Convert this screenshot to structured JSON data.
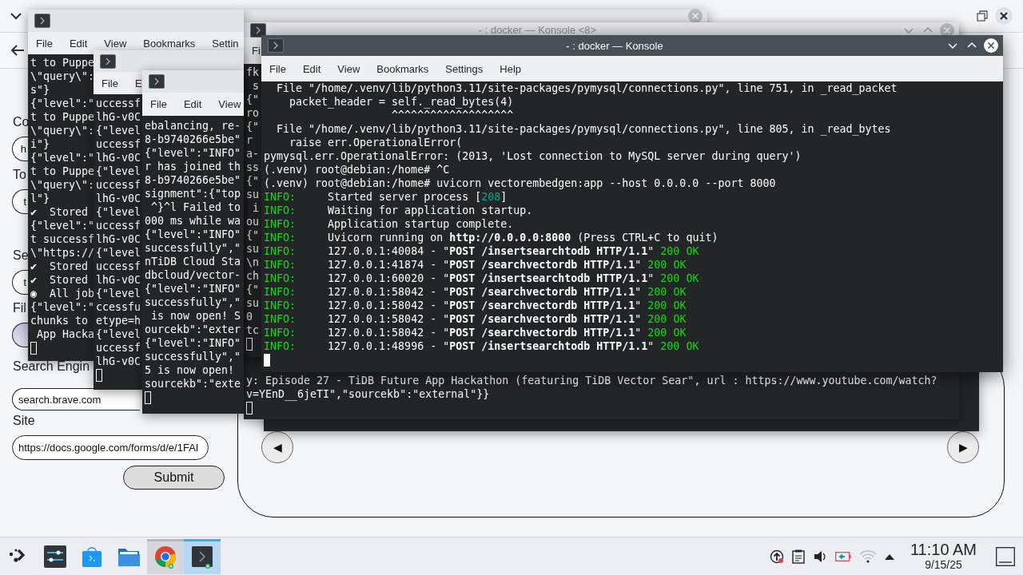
{
  "browser": {
    "form": {
      "fields": [
        {
          "kind": "text",
          "label": "Co",
          "value": "h"
        },
        {
          "kind": "text",
          "label": "To",
          "value": "t"
        },
        {
          "kind": "text",
          "label": "Se",
          "value": "t"
        },
        {
          "kind": "file",
          "label": "Fil"
        },
        {
          "kind": "text",
          "label": "Search Engin",
          "value": "search.brave.com"
        },
        {
          "kind": "text",
          "label": "Site",
          "value": "https://docs.google.com/forms/d/e/1FAI"
        }
      ],
      "submit": "Submit"
    },
    "carousel": {
      "prev": "◀",
      "next": "▶"
    }
  },
  "windows": [
    {
      "active": false
    },
    {
      "active": false,
      "menu": [
        "File",
        "Edit",
        "View",
        "Bookmarks",
        "Settin"
      ],
      "lines": [
        "t to Puppe",
        "\\\"query\\\":",
        "s\"}",
        "{\"level\":\"",
        "t to Puppe",
        "\\\"query\\\":",
        "i\"}",
        "{\"level\":\"",
        "t to Puppe",
        "\\\"query\\\":",
        "l\"}",
        "✔  Stored",
        "{\"level\":\"",
        "t successf",
        "\\\"https://",
        "✔  Stored",
        "✔  Stored",
        "◉  All job",
        "{\"level\":\"",
        "chunks to",
        " App Hacka"
      ]
    },
    {
      "active": false,
      "title": "- : docker — Konsole <8>",
      "menu": [
        "Fi"
      ],
      "lines": [
        "fk",
        " s",
        "{\"",
        "ro",
        "{\"",
        "r ",
        "a-",
        "ss",
        "{\"",
        "su",
        " i",
        "ou",
        "{\"",
        "su",
        "\\n",
        "ch",
        "{\"",
        "su",
        "0 ",
        "tc"
      ]
    },
    {
      "active": true,
      "title": "- : docker — Konsole",
      "menu": [
        "File",
        "Edit",
        "View",
        "Bookmarks",
        "Settings",
        "Help"
      ],
      "lines": [
        "  File \"/home/.venv/lib/python3.11/site-packages/pymysql/connections.py\", line 751, in _read_packet",
        "    packet_header = self._read_bytes(4)",
        "                    ^^^^^^^^^^^^^^^^^^^",
        "  File \"/home/.venv/lib/python3.11/site-packages/pymysql/connections.py\", line 805, in _read_bytes",
        "    raise err.OperationalError(",
        "pymysql.err.OperationalError: (2013, 'Lost connection to MySQL server during query')",
        "(.venv) root@debian:/home# ^C",
        "(.venv) root@debian:/home# uvicorn vectorembedgen:app --host 0.0.0.0 --port 8000",
        {
          "spans": [
            {
              "text": "INFO:",
              "kind": "level"
            },
            {
              "text": "     Started server process ["
            },
            {
              "text": "208",
              "kind": "pid"
            },
            {
              "text": "]"
            }
          ]
        },
        {
          "spans": [
            {
              "text": "INFO:",
              "kind": "level"
            },
            {
              "text": "     Waiting for application startup."
            }
          ]
        },
        {
          "spans": [
            {
              "text": "INFO:",
              "kind": "level"
            },
            {
              "text": "     Application startup complete."
            }
          ]
        },
        {
          "spans": [
            {
              "text": "INFO:",
              "kind": "level"
            },
            {
              "text": "     Uvicorn running on "
            },
            {
              "text": "http://0.0.0.0:8000",
              "kind": "url"
            },
            {
              "text": " (Press CTRL+C to quit)"
            }
          ]
        },
        {
          "spans": [
            {
              "text": "INFO:",
              "kind": "level"
            },
            {
              "text": "     127.0.0.1:40084 - \""
            },
            {
              "text": "POST /insertsearchtodb HTTP/1.1",
              "kind": "request"
            },
            {
              "text": "\" "
            },
            {
              "text": "200 OK",
              "kind": "status"
            }
          ]
        },
        {
          "spans": [
            {
              "text": "INFO:",
              "kind": "level"
            },
            {
              "text": "     127.0.0.1:41874 - \""
            },
            {
              "text": "POST /searchvectordb HTTP/1.1",
              "kind": "request"
            },
            {
              "text": "\" "
            },
            {
              "text": "200 OK",
              "kind": "status"
            }
          ]
        },
        {
          "spans": [
            {
              "text": "INFO:",
              "kind": "level"
            },
            {
              "text": "     127.0.0.1:60020 - \""
            },
            {
              "text": "POST /insertsearchtodb HTTP/1.1",
              "kind": "request"
            },
            {
              "text": "\" "
            },
            {
              "text": "200 OK",
              "kind": "status"
            }
          ]
        },
        {
          "spans": [
            {
              "text": "INFO:",
              "kind": "level"
            },
            {
              "text": "     127.0.0.1:58042 - \""
            },
            {
              "text": "POST /searchvectordb HTTP/1.1",
              "kind": "request"
            },
            {
              "text": "\" "
            },
            {
              "text": "200 OK",
              "kind": "status"
            }
          ]
        },
        {
          "spans": [
            {
              "text": "INFO:",
              "kind": "level"
            },
            {
              "text": "     127.0.0.1:58042 - \""
            },
            {
              "text": "POST /searchvectordb HTTP/1.1",
              "kind": "request"
            },
            {
              "text": "\" "
            },
            {
              "text": "200 OK",
              "kind": "status"
            }
          ]
        },
        {
          "spans": [
            {
              "text": "INFO:",
              "kind": "level"
            },
            {
              "text": "     127.0.0.1:58042 - \""
            },
            {
              "text": "POST /searchvectordb HTTP/1.1",
              "kind": "request"
            },
            {
              "text": "\" "
            },
            {
              "text": "200 OK",
              "kind": "status"
            }
          ]
        },
        {
          "spans": [
            {
              "text": "INFO:",
              "kind": "level"
            },
            {
              "text": "     127.0.0.1:58042 - \""
            },
            {
              "text": "POST /searchvectordb HTTP/1.1",
              "kind": "request"
            },
            {
              "text": "\" "
            },
            {
              "text": "200 OK",
              "kind": "status"
            }
          ]
        },
        {
          "spans": [
            {
              "text": "INFO:",
              "kind": "level"
            },
            {
              "text": "     127.0.0.1:48996 - \""
            },
            {
              "text": "POST /insertsearchtodb HTTP/1.1",
              "kind": "request"
            },
            {
              "text": "\" "
            },
            {
              "text": "200 OK",
              "kind": "status"
            }
          ]
        }
      ]
    },
    {
      "active": false,
      "menu": [
        "File",
        "E"
      ],
      "lines": [
        "uccessf",
        "lhG-v0C",
        "{\"level",
        "uccessf",
        "lhG-v0C",
        "{\"level",
        "uccessf",
        "lhG-v0C",
        "{\"level",
        "uccessf",
        "lhG-v0C",
        "{\"level",
        "uccessf",
        "lhG-v0C",
        "{\"level",
        "ccessfu",
        "etype=h",
        "{\"level",
        "uccessf",
        "lhG-v0C"
      ]
    },
    {
      "active": false,
      "menu": [
        "File",
        "Edit",
        "View"
      ],
      "lines": [
        "ebalancing, re-",
        "8-b9740266e5be\"",
        "{\"level\":\"INFO\"",
        "r has joined th",
        "8-b9740266e5be\"",
        "signment\":{\"top",
        " ^}^l Failed to",
        "000 ms while wa",
        "{\"level\":\"INFO\"",
        "successfully\",\"",
        "nTiDB Cloud Sta",
        "dbcloud/vector-",
        "{\"level\":\"INFO\"",
        "successfully\",\"",
        " is now open! S",
        "ourcekb\":\"exter",
        "{\"level\":\"INFO\"",
        "successfully\",\"",
        "5 is now open! ",
        "sourcekb\":\"exte"
      ]
    },
    {
      "active": false,
      "lines": [
        "y: Episode 27 - TiDB Future App Hackathon (featuring TiDB Vector Sear\", url : https://www.youtube.com/watch?",
        "v=YEnD__6jeTI\",\"sourcekb\":\"external\"}}"
      ]
    },
    {
      "active": false
    }
  ],
  "taskbar": {
    "tasks": [
      {
        "open": false,
        "active": false
      },
      {
        "open": false,
        "active": false
      },
      {
        "open": false,
        "active": false
      },
      {
        "open": false,
        "active": false
      },
      {
        "open": true,
        "active": false
      },
      {
        "open": true,
        "active": true
      }
    ],
    "clock": {
      "time": "11:10 AM",
      "date": "9/15/25"
    }
  }
}
